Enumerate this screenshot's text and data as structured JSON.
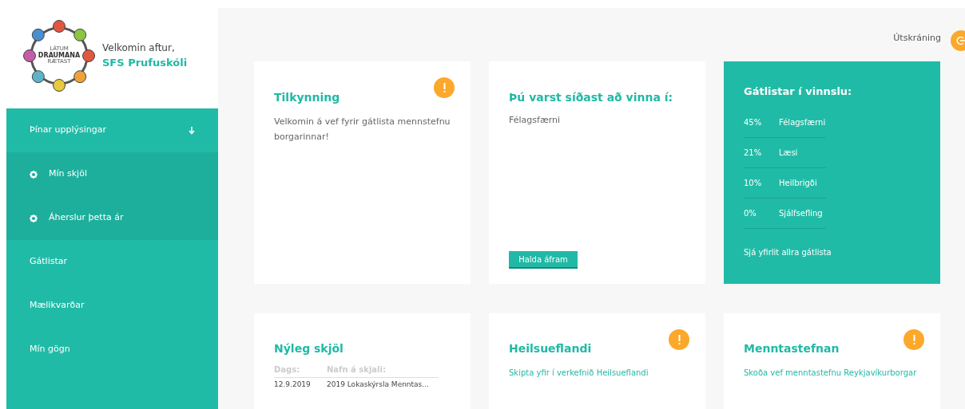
{
  "logo": {
    "lines": [
      "LÁTUM",
      "DRAUMANA",
      "RÆTAST"
    ]
  },
  "welcome": {
    "greeting": "Velkomin aftur,",
    "name": "SFS Prufuskóli"
  },
  "sidebar": {
    "items": [
      {
        "label": "Þínar upplýsingar",
        "expanded": true,
        "children": [
          {
            "label": "Mín skjöl"
          },
          {
            "label": "Áherslur þetta ár"
          }
        ]
      },
      {
        "label": "Gátlistar"
      },
      {
        "label": "Mælikvarðar"
      },
      {
        "label": "Mín gögn"
      }
    ]
  },
  "logout": {
    "label": "Útskráning"
  },
  "notice_card": {
    "title": "Tilkynning",
    "alert": true,
    "text": "Velkomin á vef fyrir gátlista mennstefnu borgarinnar!"
  },
  "last_work_card": {
    "title": "Þú varst síðast að vinna í:",
    "item": "Félagsfærni",
    "button": "Halda áfram"
  },
  "checklists_card": {
    "title": "Gátlistar í vinnslu:",
    "rows": [
      {
        "percent": "45%",
        "name": "Félagsfærni"
      },
      {
        "percent": "21%",
        "name": "Læsi"
      },
      {
        "percent": "10%",
        "name": "Heilbrigði"
      },
      {
        "percent": "0%",
        "name": "Sjálfsefling"
      }
    ],
    "link": "Sjá yfirlit allra gátlista"
  },
  "recent_docs_card": {
    "title": "Nýleg skjöl",
    "columns": [
      "Dags:",
      "Nafn á skjali:"
    ],
    "rows": [
      [
        "12.9.2019",
        "2019 Lokaskýrsla Menntas..."
      ]
    ]
  },
  "link_cards": [
    {
      "title": "Heilsueflandi",
      "alert": true,
      "link": "Skipta yfir í verkefnið Heilsueflandi"
    },
    {
      "title": "Menntastefnan",
      "alert": true,
      "link": "Skoða vef menntastefnu Reykjavíkurborgar"
    }
  ]
}
